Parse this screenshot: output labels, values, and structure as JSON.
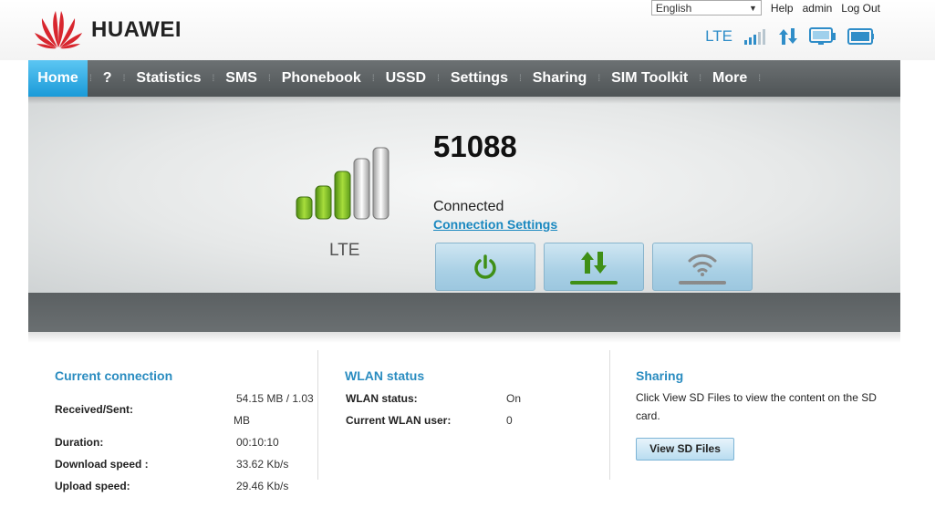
{
  "brand": {
    "name": "HUAWEI"
  },
  "topbar": {
    "language_selected": "English",
    "links": [
      "Help",
      "admin",
      "Log Out"
    ]
  },
  "status_bar": {
    "network_type": "LTE",
    "icons": [
      "signal-strength-icon",
      "data-transfer-icon",
      "monitor-icon",
      "battery-icon"
    ]
  },
  "nav": {
    "items": [
      "Home",
      "?",
      "Statistics",
      "SMS",
      "Phonebook",
      "USSD",
      "Settings",
      "Sharing",
      "SIM Toolkit",
      "More"
    ],
    "active": "Home"
  },
  "hero": {
    "signal_level": "3 of 5 bars",
    "network_type": "LTE",
    "operator": "51088",
    "connection_status": "Connected",
    "connection_settings_link": "Connection Settings",
    "buttons": [
      "power-icon",
      "data-transfer-icon",
      "wifi-icon"
    ]
  },
  "current_connection": {
    "title": "Current connection",
    "received_sent_label": "Received/Sent:",
    "received_sent_value_line1": "54.15 MB /  1.03",
    "received_sent_value_line2": "MB",
    "duration_label": "Duration:",
    "duration_value": "00:10:10",
    "download_label": "Download speed :",
    "download_value": "33.62 Kb/s",
    "upload_label": "Upload speed:",
    "upload_value": "29.46 Kb/s"
  },
  "wlan_status": {
    "title": "WLAN status",
    "status_label": "WLAN status:",
    "status_value": "On",
    "users_label": "Current WLAN user:",
    "users_value": "0"
  },
  "sharing": {
    "title": "Sharing",
    "text": "Click View SD Files to view the content on the SD card.",
    "button_label": "View SD Files"
  },
  "colors": {
    "accent": "#2a8cc0",
    "nav_bg": "#5b6062",
    "nav_active": "#1a9ad8",
    "signal_green": "#7cc12a",
    "logo_red": "#d8262e"
  }
}
